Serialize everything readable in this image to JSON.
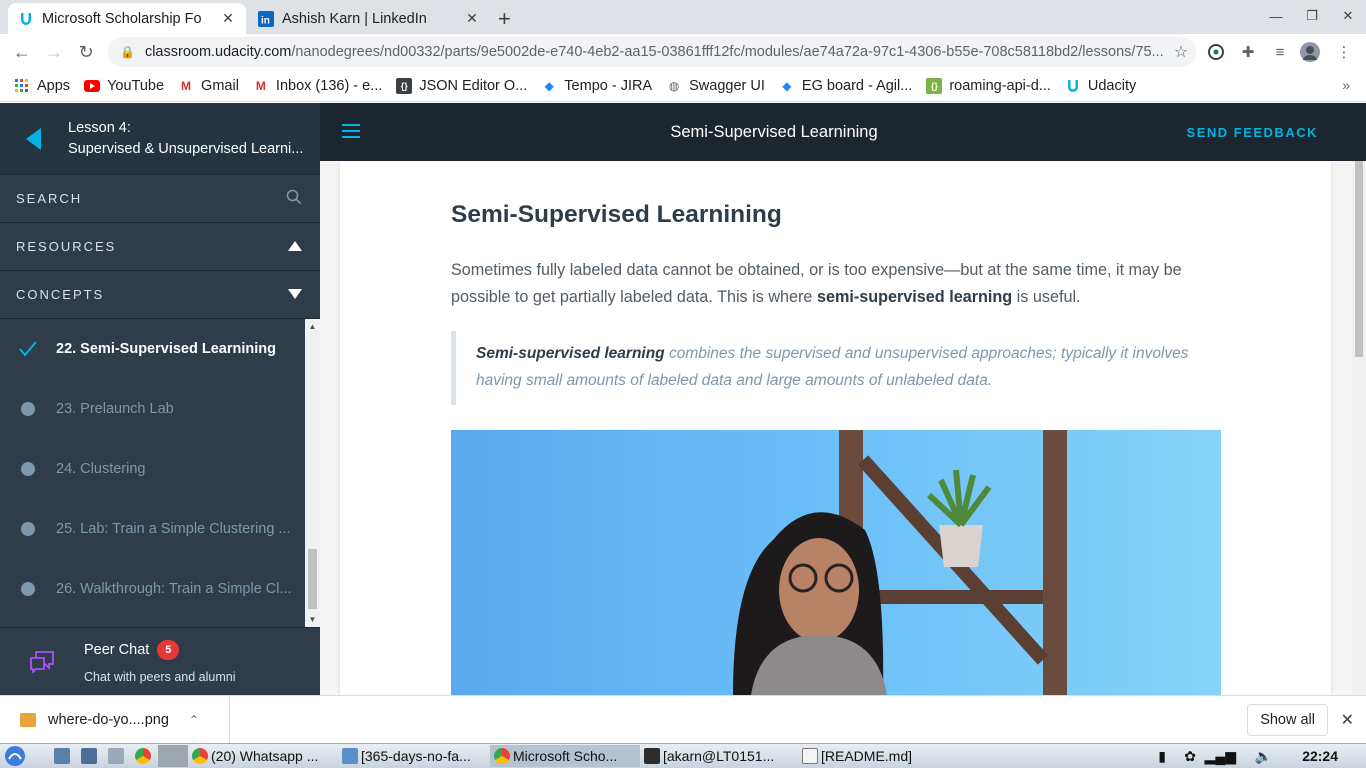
{
  "browser": {
    "tabs": [
      {
        "title": "Microsoft Scholarship Fo",
        "active": true
      },
      {
        "title": "Ashish Karn | LinkedIn",
        "active": false
      }
    ],
    "url": {
      "host": "classroom.udacity.com",
      "path": "/nanodegrees/nd00332/parts/9e5002de-e740-4eb2-aa15-03861fff12fc/modules/ae74a72a-97c1-4306-b55e-708c58118bd2/lessons/75..."
    },
    "bookmarks": [
      {
        "label": "Apps",
        "icon": "apps-grid-icon"
      },
      {
        "label": "YouTube",
        "icon": "youtube-icon"
      },
      {
        "label": "Gmail",
        "icon": "gmail-icon"
      },
      {
        "label": "Inbox (136) - e...",
        "icon": "gmail-icon"
      },
      {
        "label": "JSON Editor O...",
        "icon": "json-icon"
      },
      {
        "label": "Tempo - JIRA",
        "icon": "jira-icon"
      },
      {
        "label": "Swagger UI",
        "icon": "swagger-icon"
      },
      {
        "label": "EG board - Agil...",
        "icon": "jira-icon"
      },
      {
        "label": "roaming-api-d...",
        "icon": "api-icon"
      },
      {
        "label": "Udacity",
        "icon": "udacity-icon"
      }
    ],
    "bookmarks_more": "»"
  },
  "sidebar": {
    "lesson_label": "Lesson 4:",
    "lesson_title": "Supervised & Unsupervised Learni...",
    "search_label": "SEARCH",
    "resources_label": "RESOURCES",
    "concepts_label": "CONCEPTS",
    "concepts": [
      {
        "label": "22. Semi-Supervised Learnining",
        "status": "current"
      },
      {
        "label": "23. Prelaunch Lab",
        "status": "unvisited"
      },
      {
        "label": "24. Clustering",
        "status": "unvisited"
      },
      {
        "label": "25. Lab: Train a Simple Clustering ...",
        "status": "unvisited"
      },
      {
        "label": "26. Walkthrough: Train a Simple Cl...",
        "status": "unvisited"
      }
    ],
    "peer_chat": {
      "title": "Peer Chat",
      "badge": "5",
      "subtitle": "Chat with peers and alumni"
    }
  },
  "topbar": {
    "title": "Semi-Supervised Learnining",
    "feedback": "SEND FEEDBACK"
  },
  "content": {
    "heading": "Semi-Supervised Learnining",
    "para_1": "Sometimes fully labeled data cannot be obtained, or is too expensive—but at the same time, it may be possible to get partially labeled data. This is where ",
    "para_bold": "semi-supervised learning",
    "para_2": " is useful.",
    "quote_bold": "Semi-supervised learning",
    "quote_rest": " combines the supervised and unsupervised approaches; typically it involves having small amounts of labeled data and large amounts of unlabeled data."
  },
  "downloads": {
    "file": "where-do-yo....png",
    "show_all": "Show all"
  },
  "taskbar": {
    "items": [
      "(20) Whatsapp ...",
      "[365-days-no-fa...",
      "Microsoft Scho...",
      "[akarn@LT0151...",
      "[README.md]"
    ],
    "clock": "22:24"
  },
  "colors": {
    "accent": "#02b3e4",
    "sidebar": "#2e3d49",
    "topbar": "#1c262f",
    "badge": "#e53935"
  }
}
